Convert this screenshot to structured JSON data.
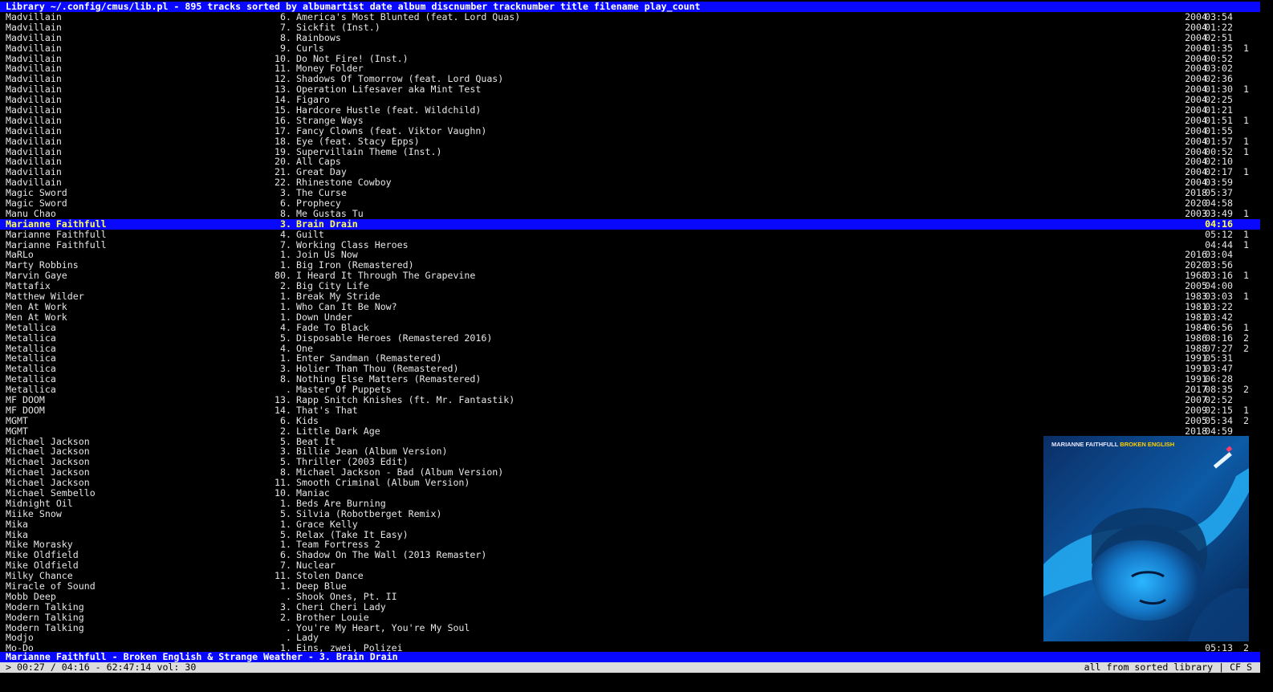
{
  "window": {
    "title": "Library ~/.config/cmus/lib.pl - 895 tracks sorted by albumartist date album discnumber tracknumber title filename play_count"
  },
  "colors": {
    "bar": "#0808ff",
    "selected_text": "#ffff55",
    "status_bg": "#dcdcdc",
    "text": "#e6e6e6",
    "background": "#000000"
  },
  "tracks": [
    {
      "artist": "Madvillain",
      "num": "6.",
      "title": "America's Most Blunted (feat. Lord Quas)",
      "year": "2004",
      "duration": "03:54",
      "plays": ""
    },
    {
      "artist": "Madvillain",
      "num": "7.",
      "title": "Sickfit (Inst.)",
      "year": "2004",
      "duration": "01:22",
      "plays": ""
    },
    {
      "artist": "Madvillain",
      "num": "8.",
      "title": "Rainbows",
      "year": "2004",
      "duration": "02:51",
      "plays": ""
    },
    {
      "artist": "Madvillain",
      "num": "9.",
      "title": "Curls",
      "year": "2004",
      "duration": "01:35",
      "plays": "1"
    },
    {
      "artist": "Madvillain",
      "num": "10.",
      "title": "Do Not Fire! (Inst.)",
      "year": "2004",
      "duration": "00:52",
      "plays": ""
    },
    {
      "artist": "Madvillain",
      "num": "11.",
      "title": "Money Folder",
      "year": "2004",
      "duration": "03:02",
      "plays": ""
    },
    {
      "artist": "Madvillain",
      "num": "12.",
      "title": "Shadows Of Tomorrow (feat. Lord Quas)",
      "year": "2004",
      "duration": "02:36",
      "plays": ""
    },
    {
      "artist": "Madvillain",
      "num": "13.",
      "title": "Operation Lifesaver aka Mint Test",
      "year": "2004",
      "duration": "01:30",
      "plays": "1"
    },
    {
      "artist": "Madvillain",
      "num": "14.",
      "title": "Figaro",
      "year": "2004",
      "duration": "02:25",
      "plays": ""
    },
    {
      "artist": "Madvillain",
      "num": "15.",
      "title": "Hardcore Hustle (feat. Wildchild)",
      "year": "2004",
      "duration": "01:21",
      "plays": ""
    },
    {
      "artist": "Madvillain",
      "num": "16.",
      "title": "Strange Ways",
      "year": "2004",
      "duration": "01:51",
      "plays": "1"
    },
    {
      "artist": "Madvillain",
      "num": "17.",
      "title": "Fancy Clowns (feat. Viktor Vaughn)",
      "year": "2004",
      "duration": "01:55",
      "plays": ""
    },
    {
      "artist": "Madvillain",
      "num": "18.",
      "title": "Eye (feat. Stacy Epps)",
      "year": "2004",
      "duration": "01:57",
      "plays": "1"
    },
    {
      "artist": "Madvillain",
      "num": "19.",
      "title": "Supervillain Theme (Inst.)",
      "year": "2004",
      "duration": "00:52",
      "plays": "1"
    },
    {
      "artist": "Madvillain",
      "num": "20.",
      "title": "All Caps",
      "year": "2004",
      "duration": "02:10",
      "plays": ""
    },
    {
      "artist": "Madvillain",
      "num": "21.",
      "title": "Great Day",
      "year": "2004",
      "duration": "02:17",
      "plays": "1"
    },
    {
      "artist": "Madvillain",
      "num": "22.",
      "title": "Rhinestone Cowboy",
      "year": "2004",
      "duration": "03:59",
      "plays": ""
    },
    {
      "artist": "Magic Sword",
      "num": "3.",
      "title": "The Curse",
      "year": "2018",
      "duration": "05:37",
      "plays": ""
    },
    {
      "artist": "Magic Sword",
      "num": "6.",
      "title": "Prophecy",
      "year": "2020",
      "duration": "04:58",
      "plays": ""
    },
    {
      "artist": "Manu Chao",
      "num": "8.",
      "title": "Me Gustas Tu",
      "year": "2003",
      "duration": "03:49",
      "plays": "1"
    },
    {
      "artist": "Marianne Faithfull",
      "num": "3.",
      "title": "Brain Drain",
      "year": "",
      "duration": "04:16",
      "plays": "",
      "selected": true
    },
    {
      "artist": "Marianne Faithfull",
      "num": "4.",
      "title": "Guilt",
      "year": "",
      "duration": "05:12",
      "plays": "1"
    },
    {
      "artist": "Marianne Faithfull",
      "num": "7.",
      "title": "Working Class Heroes",
      "year": "",
      "duration": "04:44",
      "plays": "1"
    },
    {
      "artist": "MaRLo",
      "num": "1.",
      "title": "Join Us Now",
      "year": "2016",
      "duration": "03:04",
      "plays": ""
    },
    {
      "artist": "Marty Robbins",
      "num": "1.",
      "title": "Big Iron (Remastered)",
      "year": "2020",
      "duration": "03:56",
      "plays": ""
    },
    {
      "artist": "Marvin Gaye",
      "num": "80.",
      "title": "I Heard It Through The Grapevine",
      "year": "1968",
      "duration": "03:16",
      "plays": "1"
    },
    {
      "artist": "Mattafix",
      "num": "2.",
      "title": "Big City Life",
      "year": "2005",
      "duration": "04:00",
      "plays": ""
    },
    {
      "artist": "Matthew Wilder",
      "num": "1.",
      "title": "Break My Stride",
      "year": "1983",
      "duration": "03:03",
      "plays": "1"
    },
    {
      "artist": "Men At Work",
      "num": "1.",
      "title": "Who Can It Be Now?",
      "year": "1981",
      "duration": "03:22",
      "plays": ""
    },
    {
      "artist": "Men At Work",
      "num": "1.",
      "title": "Down Under",
      "year": "1981",
      "duration": "03:42",
      "plays": ""
    },
    {
      "artist": "Metallica",
      "num": "4.",
      "title": "Fade To Black",
      "year": "1984",
      "duration": "06:56",
      "plays": "1"
    },
    {
      "artist": "Metallica",
      "num": "5.",
      "title": "Disposable Heroes (Remastered 2016)",
      "year": "1986",
      "duration": "08:16",
      "plays": "2"
    },
    {
      "artist": "Metallica",
      "num": "4.",
      "title": "One",
      "year": "1988",
      "duration": "07:27",
      "plays": "2"
    },
    {
      "artist": "Metallica",
      "num": "1.",
      "title": "Enter Sandman (Remastered)",
      "year": "1991",
      "duration": "05:31",
      "plays": ""
    },
    {
      "artist": "Metallica",
      "num": "3.",
      "title": "Holier Than Thou (Remastered)",
      "year": "1991",
      "duration": "03:47",
      "plays": ""
    },
    {
      "artist": "Metallica",
      "num": "8.",
      "title": "Nothing Else Matters (Remastered)",
      "year": "1991",
      "duration": "06:28",
      "plays": ""
    },
    {
      "artist": "Metallica",
      "num": ".",
      "title": "Master Of Puppets",
      "year": "2017",
      "duration": "08:35",
      "plays": "2"
    },
    {
      "artist": "MF DOOM",
      "num": "13.",
      "title": "Rapp Snitch Knishes (ft. Mr. Fantastik)",
      "year": "2007",
      "duration": "02:52",
      "plays": ""
    },
    {
      "artist": "MF DOOM",
      "num": "14.",
      "title": "That's That",
      "year": "2009",
      "duration": "02:15",
      "plays": "1"
    },
    {
      "artist": "MGMT",
      "num": "6.",
      "title": "Kids",
      "year": "2005",
      "duration": "05:34",
      "plays": "2"
    },
    {
      "artist": "MGMT",
      "num": "2.",
      "title": "Little Dark Age",
      "year": "2018",
      "duration": "04:59",
      "plays": ""
    },
    {
      "artist": "Michael Jackson",
      "num": "5.",
      "title": "Beat It",
      "year": "",
      "duration": "",
      "plays": ""
    },
    {
      "artist": "Michael Jackson",
      "num": "3.",
      "title": "Billie Jean (Album Version)",
      "year": "",
      "duration": "",
      "plays": ""
    },
    {
      "artist": "Michael Jackson",
      "num": "5.",
      "title": "Thriller (2003 Edit)",
      "year": "",
      "duration": "",
      "plays": ""
    },
    {
      "artist": "Michael Jackson",
      "num": "8.",
      "title": "Michael Jackson - Bad (Album Version)",
      "year": "",
      "duration": "",
      "plays": ""
    },
    {
      "artist": "Michael Jackson",
      "num": "11.",
      "title": "Smooth Criminal (Album Version)",
      "year": "",
      "duration": "",
      "plays": ""
    },
    {
      "artist": "Michael Sembello",
      "num": "10.",
      "title": "Maniac",
      "year": "",
      "duration": "",
      "plays": ""
    },
    {
      "artist": "Midnight Oil",
      "num": "1.",
      "title": "Beds Are Burning",
      "year": "",
      "duration": "",
      "plays": ""
    },
    {
      "artist": "Miike Snow",
      "num": "5.",
      "title": "Silvia (Robotberget Remix)",
      "year": "",
      "duration": "",
      "plays": ""
    },
    {
      "artist": "Mika",
      "num": "1.",
      "title": "Grace Kelly",
      "year": "",
      "duration": "",
      "plays": ""
    },
    {
      "artist": "Mika",
      "num": "5.",
      "title": "Relax (Take It Easy)",
      "year": "",
      "duration": "",
      "plays": ""
    },
    {
      "artist": "Mike Morasky",
      "num": "1.",
      "title": "Team Fortress 2",
      "year": "",
      "duration": "",
      "plays": ""
    },
    {
      "artist": "Mike Oldfield",
      "num": "6.",
      "title": "Shadow On The Wall (2013 Remaster)",
      "year": "",
      "duration": "",
      "plays": ""
    },
    {
      "artist": "Mike Oldfield",
      "num": "7.",
      "title": "Nuclear",
      "year": "",
      "duration": "",
      "plays": ""
    },
    {
      "artist": "Milky Chance",
      "num": "11.",
      "title": "Stolen Dance",
      "year": "",
      "duration": "",
      "plays": ""
    },
    {
      "artist": "Miracle of Sound",
      "num": "1.",
      "title": "Deep Blue",
      "year": "",
      "duration": "",
      "plays": ""
    },
    {
      "artist": "Mobb Deep",
      "num": ".",
      "title": "Shook Ones, Pt. II",
      "year": "",
      "duration": "",
      "plays": ""
    },
    {
      "artist": "Modern Talking",
      "num": "3.",
      "title": "Cheri Cheri Lady",
      "year": "",
      "duration": "",
      "plays": ""
    },
    {
      "artist": "Modern Talking",
      "num": "2.",
      "title": "Brother Louie",
      "year": "",
      "duration": "",
      "plays": ""
    },
    {
      "artist": "Modern Talking",
      "num": ".",
      "title": "You're My Heart, You're My Soul",
      "year": "",
      "duration": "",
      "plays": ""
    },
    {
      "artist": "Modjo",
      "num": ".",
      "title": "Lady",
      "year": "",
      "duration": "",
      "plays": ""
    },
    {
      "artist": "Mo-Do",
      "num": "1.",
      "title": "Eins, zwei, Polizei",
      "year": "",
      "duration": "05:13",
      "plays": "2"
    }
  ],
  "album_art": {
    "artist_caption": "MARIANNE FAITHFULL",
    "album_caption": "BROKEN ENGLISH",
    "icon": "album-cover-image"
  },
  "now_playing": {
    "text": "Marianne Faithfull - Broken English & Strange Weather - 3. Brain Drain"
  },
  "status": {
    "left": "> 00:27 / 04:16 - 62:47:14 vol: 30",
    "right": "all from sorted library | CF S"
  }
}
